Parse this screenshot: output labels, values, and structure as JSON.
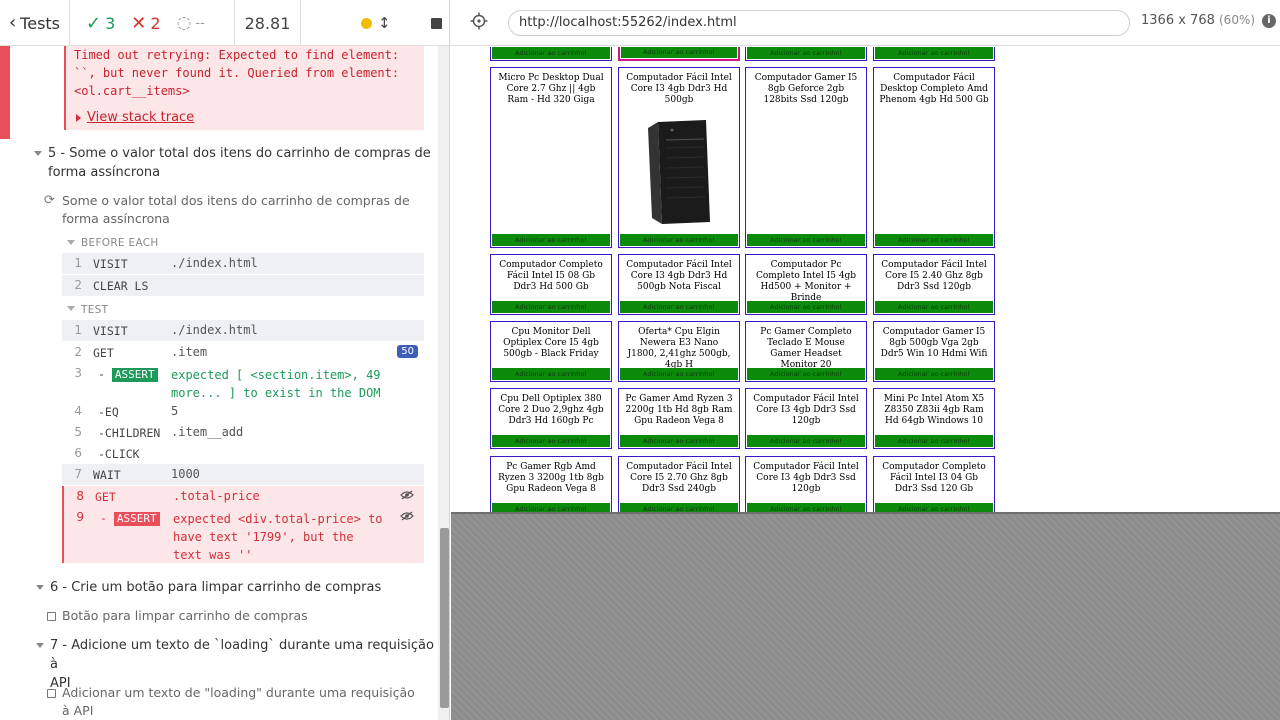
{
  "header": {
    "tests_label": "Tests",
    "passed": "3",
    "failed": "2",
    "pending": "--",
    "duration": "28.81"
  },
  "error": {
    "message": "Timed out retrying: Expected to find element:\n``, but never found it. Queried from element:\n<ol.cart__items>",
    "stack_link": "View stack trace"
  },
  "suite5": {
    "title_line1": "5 - Some o valor total dos itens do carrinho de compras de",
    "title_line2": "forma assíncrona",
    "test_line1": "Some o valor total dos itens do carrinho de compras de",
    "test_line2": "forma assíncrona",
    "before_each": "BEFORE EACH",
    "test_hdr": "TEST"
  },
  "before_each_cmds": [
    {
      "num": "1",
      "name": "VISIT",
      "msg": "./index.html"
    },
    {
      "num": "2",
      "name": "CLEAR LS",
      "msg": ""
    }
  ],
  "test_cmds": [
    {
      "num": "1",
      "name": "VISIT",
      "msg": "./index.html"
    },
    {
      "num": "2",
      "name": "GET",
      "msg": ".item",
      "badge": "50"
    },
    {
      "num": "3",
      "name": "-ASSERT",
      "msg_line1": "expected [ <section.item>, 49",
      "msg_line2": "more... ]  to exist in the DOM"
    },
    {
      "num": "4",
      "name": "-EQ",
      "msg": "5"
    },
    {
      "num": "5",
      "name": "-CHILDREN",
      "msg": ".item__add"
    },
    {
      "num": "6",
      "name": "-CLICK",
      "msg": ""
    },
    {
      "num": "7",
      "name": "WAIT",
      "msg": "1000"
    },
    {
      "num": "8",
      "name": "GET",
      "msg": ".total-price"
    },
    {
      "num": "9",
      "name": "-ASSERT",
      "msg_line1": "expected <div.total-price>  to",
      "msg_line2": "have text '1799', but the",
      "msg_line3": "text was ''"
    }
  ],
  "suite6": {
    "title": "6 - Crie um botão para limpar carrinho de compras",
    "test": "Botão para limpar carrinho de compras"
  },
  "suite7": {
    "title_line1": "7 - Adicione um texto de `loading` durante uma requisição à",
    "title_line2": "API",
    "test_line1": "Adicionar um texto de \"loading\" durante uma requisição",
    "test_line2": "à API"
  },
  "aut": {
    "url": "http://localhost:55262/index.html",
    "viewport": "1366 x 768",
    "scale": "(60%)",
    "add_label": "Adicionar ao carrinho!"
  },
  "products": [
    [
      "Micro Pc Desktop Dual Core 2.7 Ghz || 4gb Ram - Hd 320 Giga",
      "Computador Fácil Intel Core I3 4gb Ddr3 Hd 500gb",
      "Computador Gamer I5 8gb Geforce 2gb 128bits Ssd 120gb",
      "Computador Fácil Desktop Completo Amd Phenom 4gb Hd 500 Gb"
    ],
    [
      "Computador Completo Fácil Intel I5 08 Gb Ddr3 Hd 500 Gb",
      "Computador Fácil Intel Core I3 4gb Ddr3 Hd 500gb Nota Fiscal",
      "Computador Pc Completo Intel I5 4gb Hd500 + Monitor + Brinde",
      "Computador Fácil Intel Core I5 2.40 Ghz 8gb Ddr3 Ssd 120gb"
    ],
    [
      "Cpu Monitor Dell Optiplex Core I5 4gb 500gb - Black Friday",
      "Oferta* Cpu Elgin Newera E3 Nano J1800, 2,41ghz 500gb, 4gb H",
      "Pc Gamer Completo Teclado E Mouse Gamer Headset Monitor 20",
      "Computador Gamer I5 8gb 500gb Vga 2gb Ddr5 Win 10 Hdmi Wifi"
    ],
    [
      "Cpu Dell Optiplex 380 Core 2 Duo 2,9ghz 4gb Ddr3 Hd 160gb Pc",
      "Pc Gamer Amd Ryzen 3 2200g 1tb Hd 8gb Ram Gpu Radeon Vega 8",
      "Computador Fácil Intel Core I3 4gb Ddr3 Ssd 120gb",
      "Mini Pc Intel Atom X5 Z8350 Z83ii 4gb Ram Hd 64gb Windows 10"
    ],
    [
      "Pc Gamer Rgb Amd Ryzen 3 3200g 1tb 8gb Gpu Radeon Vega 8",
      "Computador Fácil Intel Core I5 2.70 Ghz 8gb Ddr3 Ssd 240gb",
      "Computador Fácil Intel Core I3 4gb Ddr3 Ssd 120gb",
      "Computador Completo Fácil Intel I3 04 Gb Ddr3 Ssd 120 Gb"
    ]
  ]
}
